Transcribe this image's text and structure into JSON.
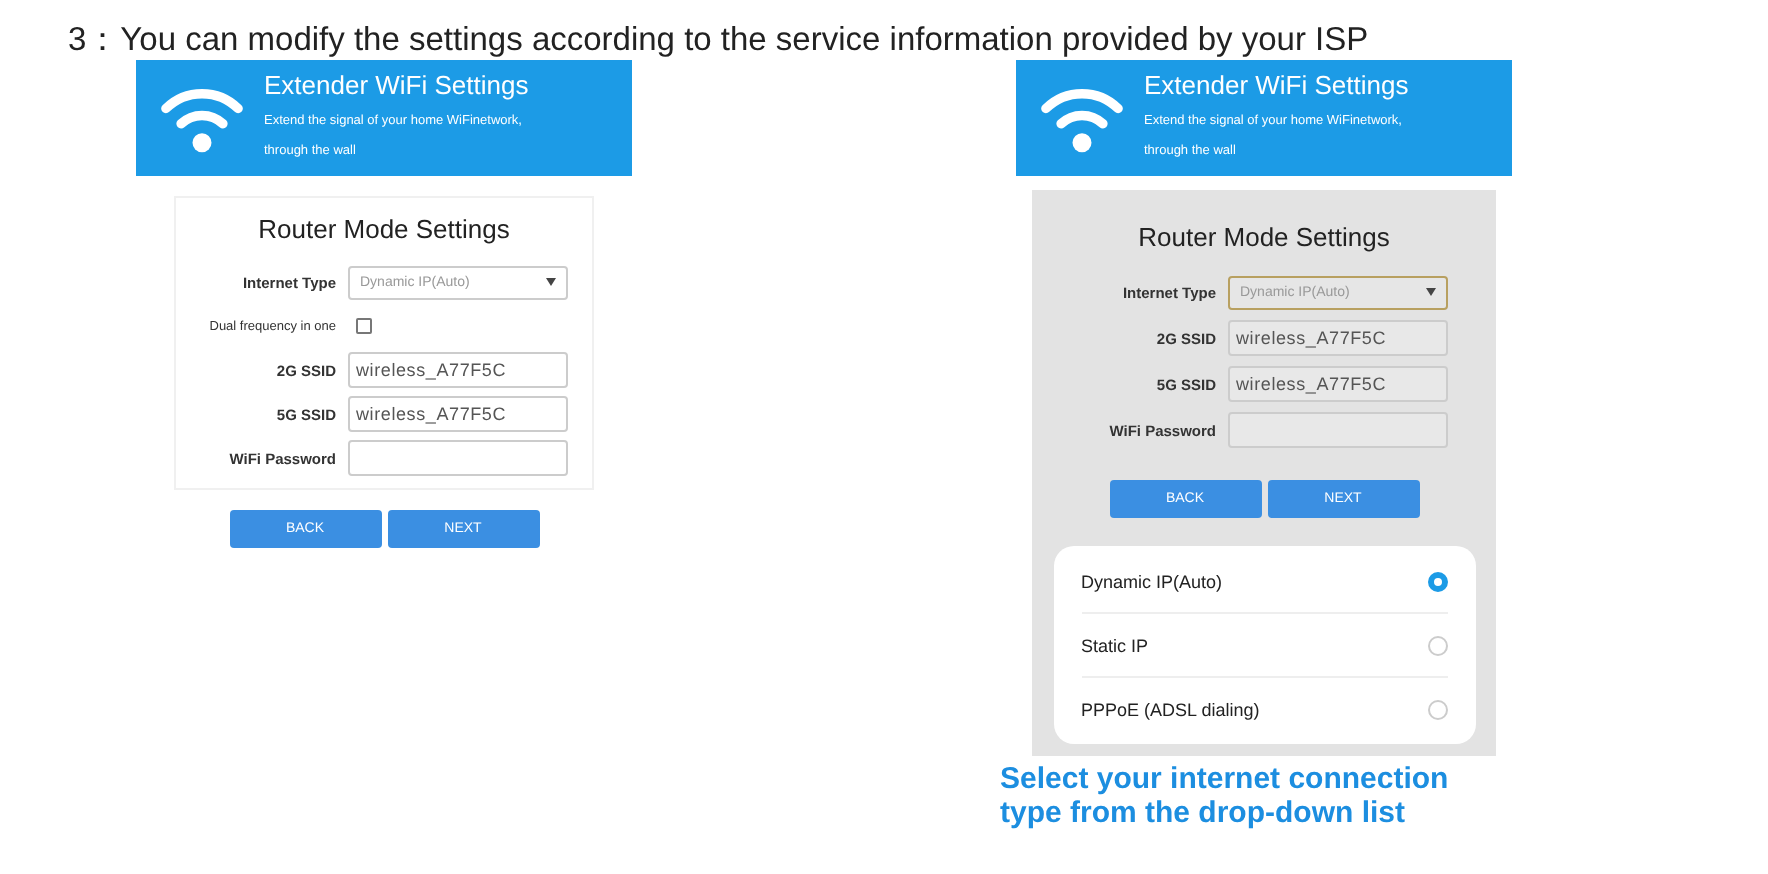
{
  "heading": "3：You can modify the settings according to the service information provided by your ISP",
  "screens": [
    {
      "header": {
        "title": "Extender WiFi Settings",
        "subtitle_lines": [
          "Extend the signal of your home WiFinetwork,",
          "through the wall"
        ]
      },
      "dimmed": false,
      "form": {
        "title": "Router Mode Settings",
        "fields": [
          {
            "kind": "select",
            "label": "Internet Type",
            "value": "Dynamic IP(Auto)"
          },
          {
            "kind": "checkbox",
            "label": "Dual frequency in one",
            "checked": false
          },
          {
            "kind": "text",
            "label": "2G SSID",
            "value": "wireless_A77F5C"
          },
          {
            "kind": "text",
            "label": "5G SSID",
            "value": "wireless_A77F5C"
          },
          {
            "kind": "text",
            "label": "WiFi Password"
          }
        ]
      },
      "buttons": [
        "BACK",
        "NEXT"
      ]
    },
    {
      "header": {
        "title": "Extender WiFi Settings",
        "subtitle_lines": [
          "Extend the signal of your home WiFinetwork,",
          "through the wall"
        ]
      },
      "dimmed": true,
      "form": {
        "title": "Router Mode Settings",
        "fields": [
          {
            "kind": "select",
            "label": "Internet Type",
            "value": "Dynamic IP(Auto)"
          },
          {
            "kind": "text",
            "label": "2G SSID",
            "value": "wireless_A77F5C"
          },
          {
            "kind": "text",
            "label": "5G SSID",
            "value": "wireless_A77F5C"
          },
          {
            "kind": "text",
            "label": "WiFi Password"
          }
        ]
      },
      "buttons": [
        "BACK",
        "NEXT"
      ],
      "options": [
        {
          "label": "Dynamic IP(Auto)",
          "selected": true
        },
        {
          "label": "Static IP",
          "selected": false
        },
        {
          "label": "PPPoE (ADSL dialing)",
          "selected": false
        }
      ]
    }
  ],
  "caption_lines": [
    "Select your internet connection",
    "type from the drop-down list"
  ]
}
